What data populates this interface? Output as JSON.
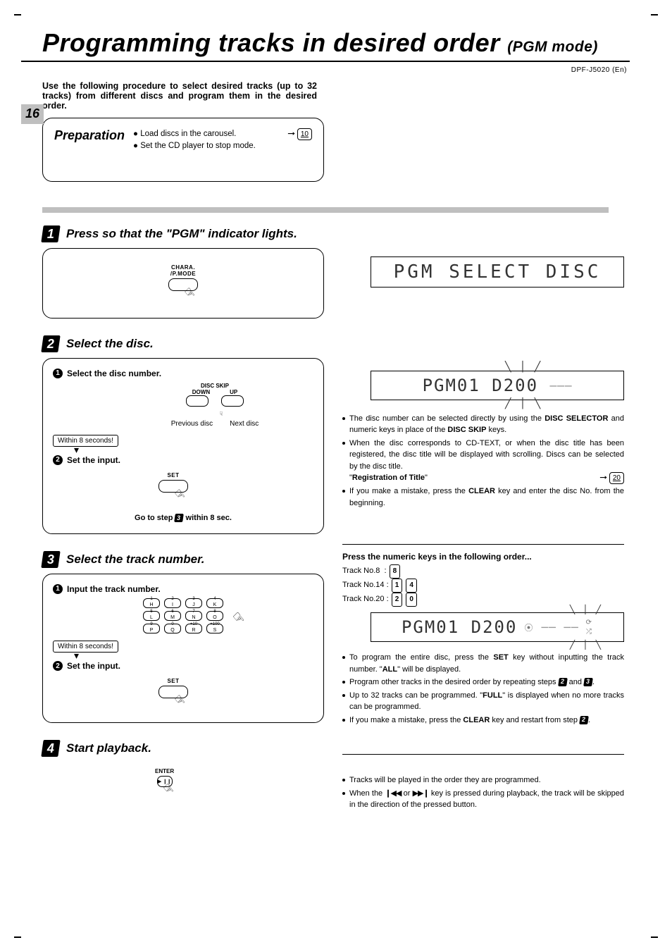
{
  "title_main": "Programming tracks in desired order",
  "title_sub": "(PGM mode)",
  "model_label": "DPF-J5020 (En)",
  "page_number": "16",
  "intro": "Use the following procedure to select desired tracks (up to 32 tracks) from different discs and program them in the desired order.",
  "prep": {
    "heading": "Preparation",
    "item1": "Load discs in the carousel.",
    "item1_ref": "10",
    "item2": "Set the CD player to stop mode."
  },
  "steps": {
    "s1": {
      "num": "1",
      "title": "Press so that the \"PGM\" indicator lights.",
      "btn_top": "CHARA.",
      "btn_bot": "/P.MODE"
    },
    "s2": {
      "num": "2",
      "title": "Select the disc.",
      "sub1": "Select the disc number.",
      "ds_label": "DISC SKIP",
      "ds_down": "DOWN",
      "ds_up": "UP",
      "prev": "Previous disc",
      "next": "Next disc",
      "within": "Within 8 seconds!",
      "sub2": "Set the input.",
      "set_label": "SET",
      "go_foot_a": "Go to step",
      "go_foot_b": "within 8 sec."
    },
    "s3": {
      "num": "3",
      "title": "Select the track number.",
      "sub1": "Input the track number.",
      "keys": [
        [
          "1",
          "H"
        ],
        [
          "2",
          "I"
        ],
        [
          "3",
          "J"
        ],
        [
          "4",
          "K"
        ],
        [
          "5",
          "L"
        ],
        [
          "6",
          "M"
        ],
        [
          "7",
          "N"
        ],
        [
          "8",
          "O"
        ],
        [
          "9",
          "P"
        ],
        [
          "0",
          "Q"
        ],
        [
          "+10",
          "R"
        ],
        [
          "+100",
          "S"
        ]
      ],
      "within": "Within 8 seconds!",
      "sub2": "Set the input.",
      "set_label": "SET"
    },
    "s4": {
      "num": "4",
      "title": "Start playback.",
      "enter_label": "ENTER",
      "play_glyph": "▶ ❙❙"
    }
  },
  "lcd1": "PGM SELECT DISC",
  "lcd2": "PGM01 D200",
  "lcd3": "PGM01 D200",
  "lcd3_extra": "⎵▓▓▓⎵",
  "notes2": {
    "n1a": "The disc number can be selected directly by using the ",
    "n1b": "DISC SELECTOR",
    "n1c": " and numeric keys in place of the ",
    "n1d": "DISC SKIP",
    "n1e": " keys.",
    "n2": "When the disc corresponds to CD-TEXT, or when the disc title has been registered, the disc title will be displayed with scrolling. Discs can be selected by the disc title.",
    "n2_ref_label": "Registration of Title",
    "n2_ref": "20",
    "n3a": "If you make a mistake, press the ",
    "n3b": "CLEAR",
    "n3c": " key and enter the disc No. from the beginning."
  },
  "order": {
    "title": "Press the numeric keys in the following order...",
    "r1_label": "Track No.8",
    "r1_keys": [
      "8"
    ],
    "r2_label": "Track No.14",
    "r2_keys": [
      "1",
      "4"
    ],
    "r3_label": "Track No.20",
    "r3_keys": [
      "2",
      "0"
    ]
  },
  "notes3": {
    "n1a": "To program the entire disc, press the ",
    "n1b": "SET",
    "n1c": " key without inputting the track number. \"",
    "n1d": "ALL",
    "n1e": "\" will be displayed.",
    "n2a": "Program other tracks in the desired order by repeating steps ",
    "n2b": " and ",
    "n2c": ".",
    "n3a": "Up to 32 tracks can be programmed. \"",
    "n3b": "FULL",
    "n3c": "\" is displayed when no more tracks can be programmed.",
    "n4a": "If you make a mistake, press the ",
    "n4b": "CLEAR",
    "n4c": " key and restart from step ",
    "n4d": "."
  },
  "notes4": {
    "n1": "Tracks will be played in the order they are programmed.",
    "n2a": "When the ",
    "n2_prev": "❙◀◀",
    "n2b": " or ",
    "n2_next": "▶▶❙",
    "n2c": " key is pressed during playback, the track will be skipped in the direction of the pressed button."
  }
}
